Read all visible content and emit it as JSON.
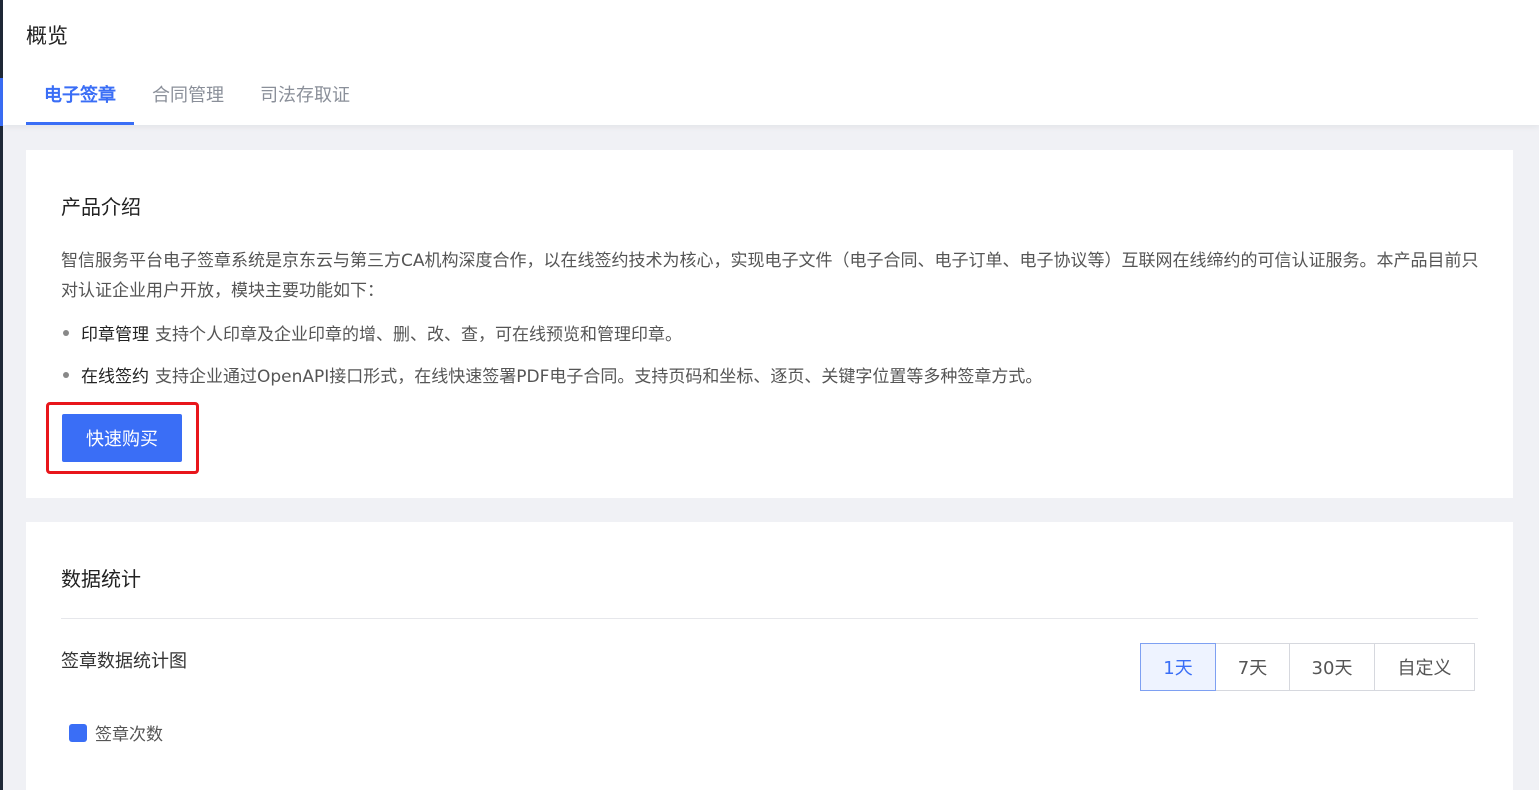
{
  "header": {
    "title": "概览",
    "tabs": [
      {
        "label": "电子签章",
        "active": true
      },
      {
        "label": "合同管理",
        "active": false
      },
      {
        "label": "司法存取证",
        "active": false
      }
    ]
  },
  "intro": {
    "title": "产品介绍",
    "description": "智信服务平台电子签章系统是京东云与第三方CA机构深度合作，以在线签约技术为核心，实现电子文件（电子合同、电子订单、电子协议等）互联网在线缔约的可信认证服务。本产品目前只对认证企业用户开放，模块主要功能如下：",
    "features": [
      {
        "term": "印章管理",
        "text": "支持个人印章及企业印章的增、删、改、查，可在线预览和管理印章。"
      },
      {
        "term": "在线签约",
        "text": "支持企业通过OpenAPI接口形式，在线快速签署PDF电子合同。支持页码和坐标、逐页、关键字位置等多种签章方式。"
      }
    ],
    "buy_button": "快速购买"
  },
  "stats": {
    "title": "数据统计",
    "chart_title": "签章数据统计图",
    "ranges": [
      {
        "label": "1天",
        "active": true
      },
      {
        "label": "7天",
        "active": false
      },
      {
        "label": "30天",
        "active": false
      },
      {
        "label": "自定义",
        "active": false
      }
    ],
    "legend_label": "签章次数"
  },
  "colors": {
    "accent": "#3a6ef6",
    "highlight_box": "#e8161b"
  }
}
